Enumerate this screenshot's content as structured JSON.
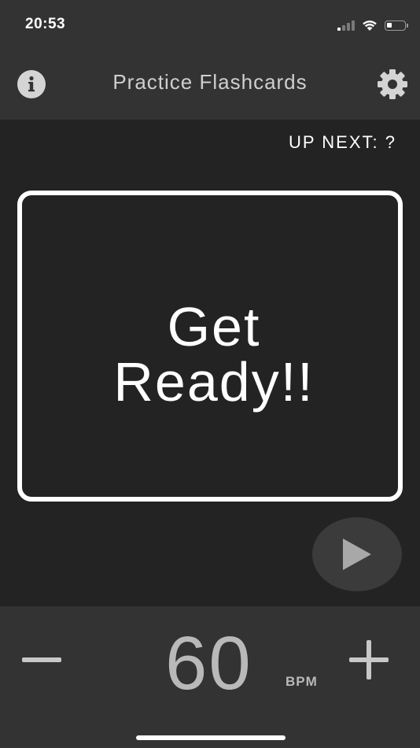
{
  "status_bar": {
    "time": "20:53",
    "battery_level": 0.3
  },
  "nav": {
    "title": "Practice Flashcards",
    "info_icon": "info-icon",
    "settings_icon": "gear-icon"
  },
  "up_next": {
    "label": "UP NEXT: ?"
  },
  "card": {
    "text": "Get\nReady!!"
  },
  "controls": {
    "play_icon": "play-icon",
    "decrease_icon": "minus-icon",
    "increase_icon": "plus-icon"
  },
  "tempo": {
    "value": "60",
    "unit": "BPM"
  },
  "colors": {
    "background": "#232323",
    "bar": "#333333",
    "text": "#ffffff",
    "muted": "#b9b9b9"
  }
}
